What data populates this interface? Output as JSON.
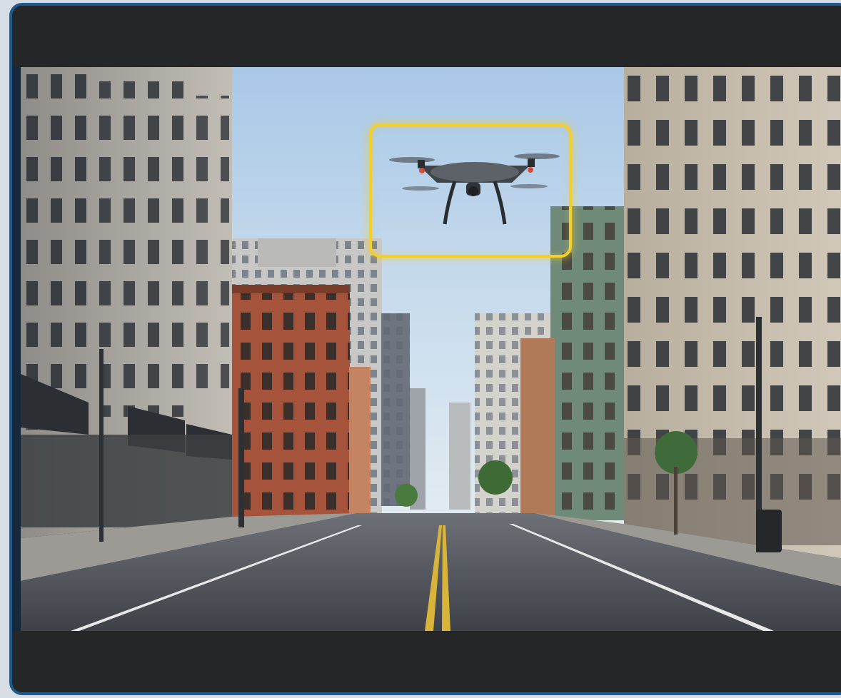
{
  "viewer": {
    "scene": "city-street",
    "detection_color": "#f2cf2a",
    "frame_color": "#1e5a8e",
    "bar_color": "#242627"
  },
  "detection": {
    "object_icon": "drone-icon",
    "box_style": "rounded-glow"
  }
}
